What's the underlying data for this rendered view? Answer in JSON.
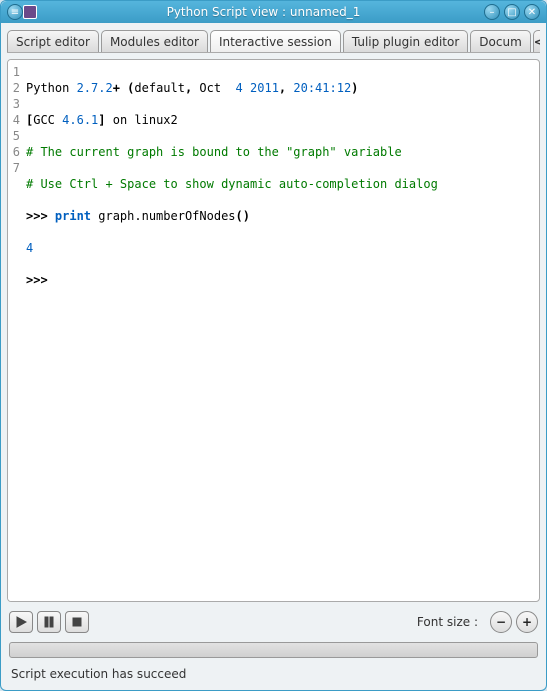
{
  "window": {
    "title": "Python Script view : unnamed_1"
  },
  "tabs": {
    "items": [
      {
        "label": "Script editor"
      },
      {
        "label": "Modules editor"
      },
      {
        "label": "Interactive session"
      },
      {
        "label": "Tulip plugin editor"
      },
      {
        "label": "Docum"
      }
    ],
    "active_index": 2,
    "scroll_left": "<",
    "scroll_right": ">"
  },
  "code": {
    "line_numbers": [
      "1",
      "2",
      "3",
      "4",
      "5",
      "6",
      "7"
    ],
    "l1_a": "Python ",
    "l1_ver": "2.7.2",
    "l1_plus": "+ (",
    "l1_b": "default",
    "l1_c": ", ",
    "l1_d": "Oct  ",
    "l1_day": "4",
    "l1_sp": " ",
    "l1_year": "2011",
    "l1_e": ", ",
    "l1_time": "20:41:12",
    "l1_close": ")",
    "l2_a": "[",
    "l2_b": "GCC ",
    "l2_ver": "4.6.1",
    "l2_c": "]",
    "l2_d": " on linux2",
    "l3": "# The current graph is bound to the \"graph\" variable",
    "l4": "# Use Ctrl + Space to show dynamic auto-completion dialog",
    "l5_prompt": ">>> ",
    "l5_kw": "print",
    "l5_rest": " graph.numberOfNodes",
    "l5_paren": "()",
    "l6": "4",
    "l7": ">>> "
  },
  "controls": {
    "font_label": "Font size :"
  },
  "status": {
    "text": "Script execution has succeed"
  }
}
